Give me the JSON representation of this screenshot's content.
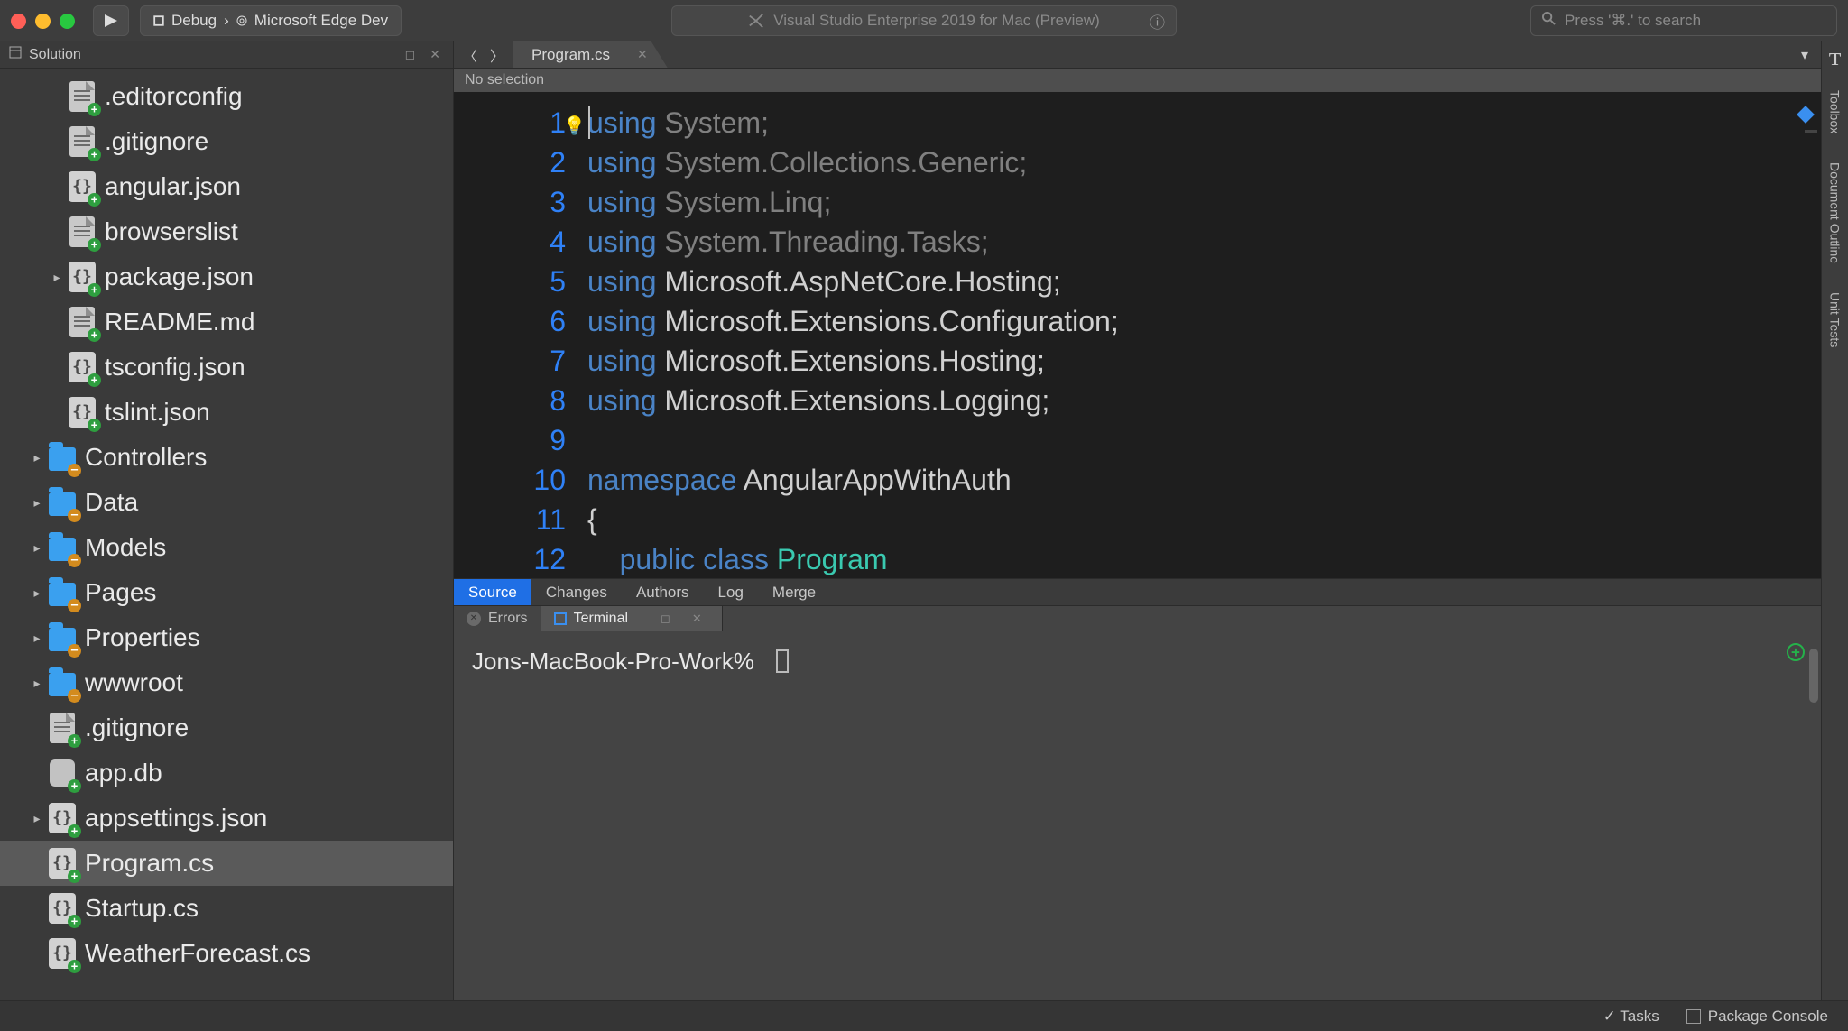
{
  "toolbar": {
    "config_debug": "Debug",
    "config_target": "Microsoft Edge Dev",
    "app_title": "Visual Studio Enterprise 2019 for Mac (Preview)",
    "search_placeholder": "Press '⌘.' to search"
  },
  "solution": {
    "pad_title": "Solution",
    "items": [
      {
        "name": ".editorconfig",
        "kind": "sheet-lines",
        "expander": "none",
        "badge": "plus",
        "indent": 2
      },
      {
        "name": ".gitignore",
        "kind": "sheet-lines",
        "expander": "none",
        "badge": "plus",
        "indent": 2
      },
      {
        "name": "angular.json",
        "kind": "code",
        "expander": "none",
        "badge": "plus",
        "indent": 2
      },
      {
        "name": "browserslist",
        "kind": "sheet-lines",
        "expander": "none",
        "badge": "plus",
        "indent": 2
      },
      {
        "name": "package.json",
        "kind": "code",
        "expander": "closed",
        "badge": "plus",
        "indent": 2
      },
      {
        "name": "README.md",
        "kind": "sheet-lines",
        "expander": "none",
        "badge": "plus",
        "indent": 2
      },
      {
        "name": "tsconfig.json",
        "kind": "code",
        "expander": "none",
        "badge": "plus",
        "indent": 2
      },
      {
        "name": "tslint.json",
        "kind": "code",
        "expander": "none",
        "badge": "plus",
        "indent": 2
      },
      {
        "name": "Controllers",
        "kind": "folder",
        "expander": "closed",
        "badge": "minus",
        "indent": 1
      },
      {
        "name": "Data",
        "kind": "folder",
        "expander": "closed",
        "badge": "minus",
        "indent": 1
      },
      {
        "name": "Models",
        "kind": "folder",
        "expander": "closed",
        "badge": "minus",
        "indent": 1
      },
      {
        "name": "Pages",
        "kind": "folder",
        "expander": "closed",
        "badge": "minus",
        "indent": 1
      },
      {
        "name": "Properties",
        "kind": "folder",
        "expander": "closed",
        "badge": "minus",
        "indent": 1
      },
      {
        "name": "wwwroot",
        "kind": "folder",
        "expander": "closed",
        "badge": "minus",
        "indent": 1
      },
      {
        "name": ".gitignore",
        "kind": "sheet-lines",
        "expander": "none",
        "badge": "plus",
        "indent": 1
      },
      {
        "name": "app.db",
        "kind": "db",
        "expander": "none",
        "badge": "plus",
        "indent": 1
      },
      {
        "name": "appsettings.json",
        "kind": "code",
        "expander": "closed",
        "badge": "plus",
        "indent": 1
      },
      {
        "name": "Program.cs",
        "kind": "code",
        "expander": "none",
        "badge": "plus",
        "indent": 1,
        "selected": true
      },
      {
        "name": "Startup.cs",
        "kind": "code",
        "expander": "none",
        "badge": "plus",
        "indent": 1
      },
      {
        "name": "WeatherForecast.cs",
        "kind": "code",
        "expander": "none",
        "badge": "plus",
        "indent": 1
      }
    ]
  },
  "editor": {
    "tab_label": "Program.cs",
    "breadcrumb": "No selection",
    "line_count": 12,
    "code_tokens": [
      [
        [
          "kw",
          "using"
        ],
        [
          "dim",
          " System;"
        ]
      ],
      [
        [
          "kw",
          "using"
        ],
        [
          "dim",
          " System.Collections.Generic;"
        ]
      ],
      [
        [
          "kw",
          "using"
        ],
        [
          "dim",
          " System.Linq;"
        ]
      ],
      [
        [
          "kw",
          "using"
        ],
        [
          "dim",
          " System.Threading.Tasks;"
        ]
      ],
      [
        [
          "kw",
          "using"
        ],
        [
          "txt",
          " Microsoft.AspNetCore.Hosting;"
        ]
      ],
      [
        [
          "kw",
          "using"
        ],
        [
          "txt",
          " Microsoft.Extensions.Configuration;"
        ]
      ],
      [
        [
          "kw",
          "using"
        ],
        [
          "txt",
          " Microsoft.Extensions.Hosting;"
        ]
      ],
      [
        [
          "kw",
          "using"
        ],
        [
          "txt",
          " Microsoft.Extensions.Logging;"
        ]
      ],
      [
        [
          "txt",
          ""
        ]
      ],
      [
        [
          "kw",
          "namespace"
        ],
        [
          "txt",
          " AngularAppWithAuth"
        ]
      ],
      [
        [
          "txt",
          "{"
        ]
      ],
      [
        [
          "txt",
          "    "
        ],
        [
          "kw",
          "public"
        ],
        [
          "txt",
          " "
        ],
        [
          "kw",
          "class"
        ],
        [
          "txt",
          " "
        ],
        [
          "typ",
          "Program"
        ]
      ]
    ]
  },
  "source_control_tabs": [
    "Source",
    "Changes",
    "Authors",
    "Log",
    "Merge"
  ],
  "bottom_panels": {
    "errors_label": "Errors",
    "terminal_label": "Terminal",
    "terminal_prompt": "Jons-MacBook-Pro-Work%"
  },
  "right_tabs": [
    "Toolbox",
    "Document Outline",
    "Unit Tests"
  ],
  "statusbar": {
    "tasks": "Tasks",
    "package_console": "Package Console"
  }
}
